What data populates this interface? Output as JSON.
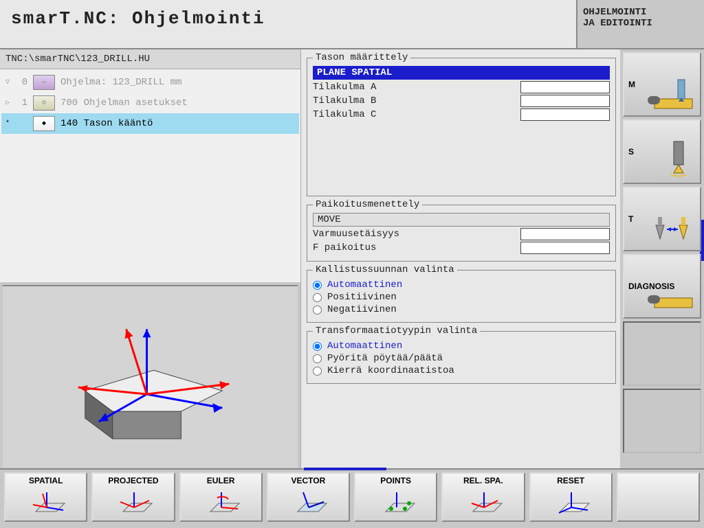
{
  "header": {
    "title": "smarT.NC: Ohjelmointi",
    "right_line1": "OHJELMOINTI",
    "right_line2": "JA EDITOINTI"
  },
  "file_path": "TNC:\\smarTNC\\123_DRILL.HU",
  "tree": {
    "items": [
      {
        "arrow": "▽",
        "num": "0",
        "label": "Ohjelma: 123_DRILL mm",
        "dim": true,
        "sel": false
      },
      {
        "arrow": "▷",
        "num": "1",
        "label": "700 Ohjelman asetukset",
        "dim": true,
        "sel": false
      },
      {
        "arrow": "*",
        "num": "",
        "label": "140 Tason kääntö",
        "dim": false,
        "sel": true
      }
    ]
  },
  "panel1": {
    "legend": "Tason määrittely",
    "highlight": "PLANE SPATIAL",
    "rows": [
      {
        "label": "Tilakulma A",
        "value": ""
      },
      {
        "label": "Tilakulma B",
        "value": ""
      },
      {
        "label": "Tilakulma C",
        "value": ""
      }
    ]
  },
  "panel2": {
    "legend": "Paikoitusmenettely",
    "display": "MOVE",
    "rows": [
      {
        "label": "Varmuusetäisyys",
        "value": ""
      },
      {
        "label": "F paikoitus",
        "value": ""
      }
    ]
  },
  "panel3": {
    "legend": "Kallistussuunnan valinta",
    "options": [
      {
        "label": "Automaattinen",
        "checked": true,
        "auto": true
      },
      {
        "label": "Positiivinen",
        "checked": false,
        "auto": false
      },
      {
        "label": "Negatiivinen",
        "checked": false,
        "auto": false
      }
    ]
  },
  "panel4": {
    "legend": "Transformaatiotyypin valinta",
    "options": [
      {
        "label": "Automaattinen",
        "checked": true,
        "auto": true
      },
      {
        "label": "Pyöritä pöytää/päätä",
        "checked": false,
        "auto": false
      },
      {
        "label": "Kierrä koordinaatistoa",
        "checked": false,
        "auto": false
      }
    ]
  },
  "side": {
    "buttons": [
      {
        "label": "M",
        "icon": "machine"
      },
      {
        "label": "S",
        "icon": "spindle"
      },
      {
        "label": "T",
        "icon": "tool"
      },
      {
        "label": "DIAGNOSIS",
        "icon": "diag"
      },
      {
        "label": "",
        "icon": ""
      },
      {
        "label": "",
        "icon": ""
      }
    ]
  },
  "softkeys": [
    {
      "label": "SPATIAL"
    },
    {
      "label": "PROJECTED"
    },
    {
      "label": "EULER"
    },
    {
      "label": "VECTOR"
    },
    {
      "label": "POINTS"
    },
    {
      "label": "REL. SPA."
    },
    {
      "label": "RESET"
    },
    {
      "label": ""
    }
  ]
}
